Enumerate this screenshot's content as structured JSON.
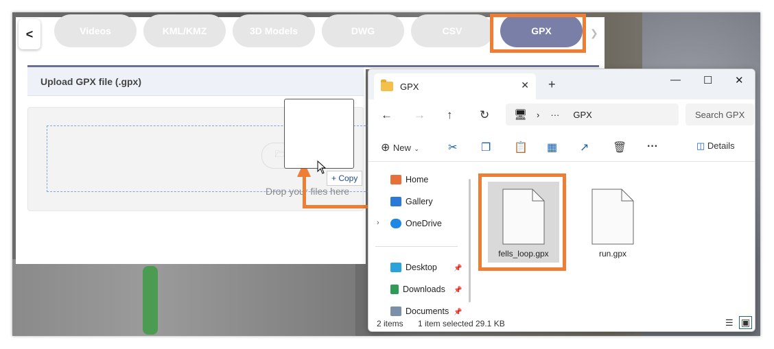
{
  "web": {
    "back_label": "<",
    "tabs": [
      "Videos",
      "KML/KMZ",
      "3D Models",
      "DWG",
      "CSV",
      "GPX"
    ],
    "active_tab": "GPX",
    "upload_title": "Upload GPX file (.gpx)",
    "browse_label": "Br",
    "drop_text": "Drop your files here",
    "copy_tip": "+ Copy"
  },
  "explorer": {
    "tab_title": "GPX",
    "breadcrumb_ellipsis": "···",
    "breadcrumb_current": "GPX",
    "search_placeholder": "Search GPX",
    "new_label": "New",
    "details_label": "Details",
    "more_label": "···",
    "sidebar": [
      {
        "label": "Home",
        "icon": "home-icon"
      },
      {
        "label": "Gallery",
        "icon": "gallery-icon"
      },
      {
        "label": "OneDrive",
        "icon": "onedrive-icon"
      },
      {
        "label": "Desktop",
        "icon": "desktop-icon"
      },
      {
        "label": "Downloads",
        "icon": "downloads-icon"
      },
      {
        "label": "Documents",
        "icon": "documents-icon"
      }
    ],
    "files": [
      {
        "name": "fells_loop.gpx",
        "selected": true
      },
      {
        "name": "run.gpx",
        "selected": false
      }
    ],
    "status": {
      "items": "2 items",
      "selected": "1 item selected",
      "size": "29.1 KB"
    }
  },
  "colors": {
    "accent_orange": "#ee7e33",
    "active_tab": "#7a7fa7",
    "inactive_tab": "#e6e6e6"
  }
}
